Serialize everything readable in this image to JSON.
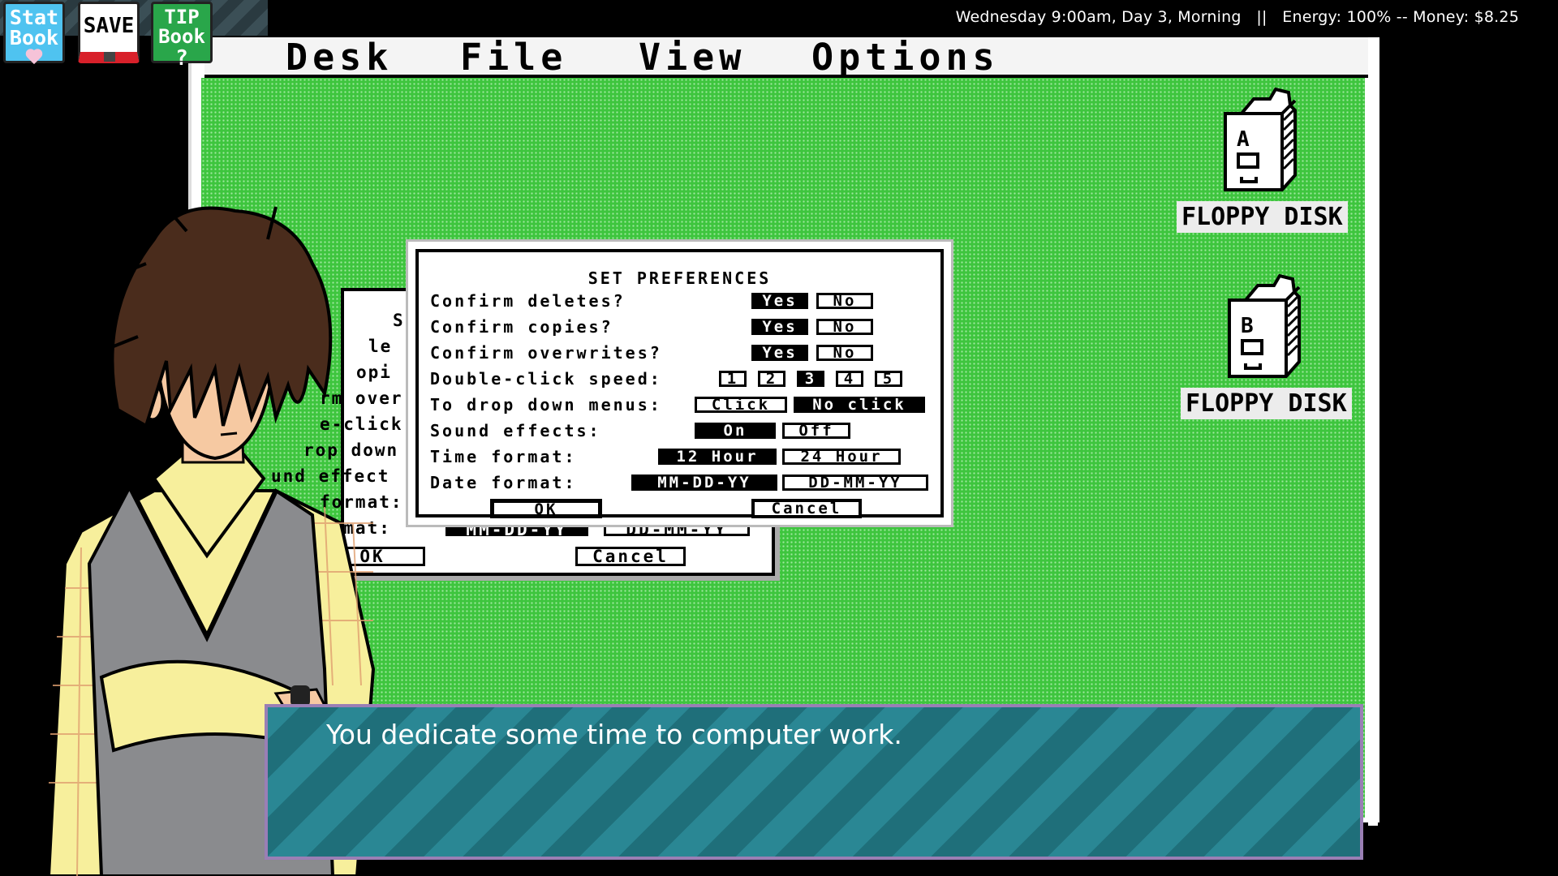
{
  "hud": {
    "status": "Wednesday 9:00am, Day 3, Morning   ||   Energy: 100% -- Money: $8.25",
    "stat_book_line1": "Stat",
    "stat_book_line2": "Book",
    "save_label": "SAVE",
    "tip_book_line1": "TIP",
    "tip_book_line2": "Book",
    "tip_book_mark": "?"
  },
  "menubar": {
    "desk": "Desk",
    "file": "File",
    "view": "View",
    "options": "Options"
  },
  "desktop": {
    "floppy_a": {
      "letter": "A",
      "label": "FLOPPY DISK"
    },
    "floppy_b": {
      "letter": "B",
      "label": "FLOPPY DISK"
    }
  },
  "back_dialog": {
    "row1": "S",
    "row2": "le",
    "row3": "opi",
    "row4": "rm over",
    "row5": "e-click",
    "row6": "rop down",
    "row7": "und effect",
    "row8": "format:",
    "row9": "ormat:",
    "opt_date1": "MM-DD-YY",
    "opt_date2": "DD-MM-YY",
    "ok": "OK",
    "cancel": "Cancel"
  },
  "preferences": {
    "title": "SET PREFERENCES",
    "confirm_deletes": {
      "label": "Confirm deletes?",
      "yes": "Yes",
      "no": "No",
      "selected": "Yes"
    },
    "confirm_copies": {
      "label": "Confirm copies?",
      "yes": "Yes",
      "no": "No",
      "selected": "Yes"
    },
    "confirm_overwrites": {
      "label": "Confirm overwrites?",
      "yes": "Yes",
      "no": "No",
      "selected": "Yes"
    },
    "double_click": {
      "label": "Double-click speed:",
      "options": [
        "1",
        "2",
        "3",
        "4",
        "5"
      ],
      "selected": "3"
    },
    "drop_down": {
      "label": "To drop down menus:",
      "click": "Click",
      "no_click": "No click",
      "selected": "No click"
    },
    "sound": {
      "label": "Sound effects:",
      "on": "On",
      "off": "Off",
      "selected": "On"
    },
    "time_format": {
      "label": "Time format:",
      "h12": "12 Hour",
      "h24": "24 Hour",
      "selected": "12 Hour"
    },
    "date_format": {
      "label": "Date format:",
      "mdy": "MM-DD-YY",
      "dmy": "DD-MM-YY",
      "selected": "MM-DD-YY"
    },
    "ok": "OK",
    "cancel": "Cancel"
  },
  "dialogue": {
    "text": "You dedicate some time to computer work."
  },
  "colors": {
    "desktop_green": "#3ec53e",
    "dialogue_teal": "#1f6f7a",
    "dialogue_border": "#9a7fb5",
    "stat_book": "#4fc3f0",
    "save_red": "#d8202a",
    "tip_book": "#29a64a"
  }
}
